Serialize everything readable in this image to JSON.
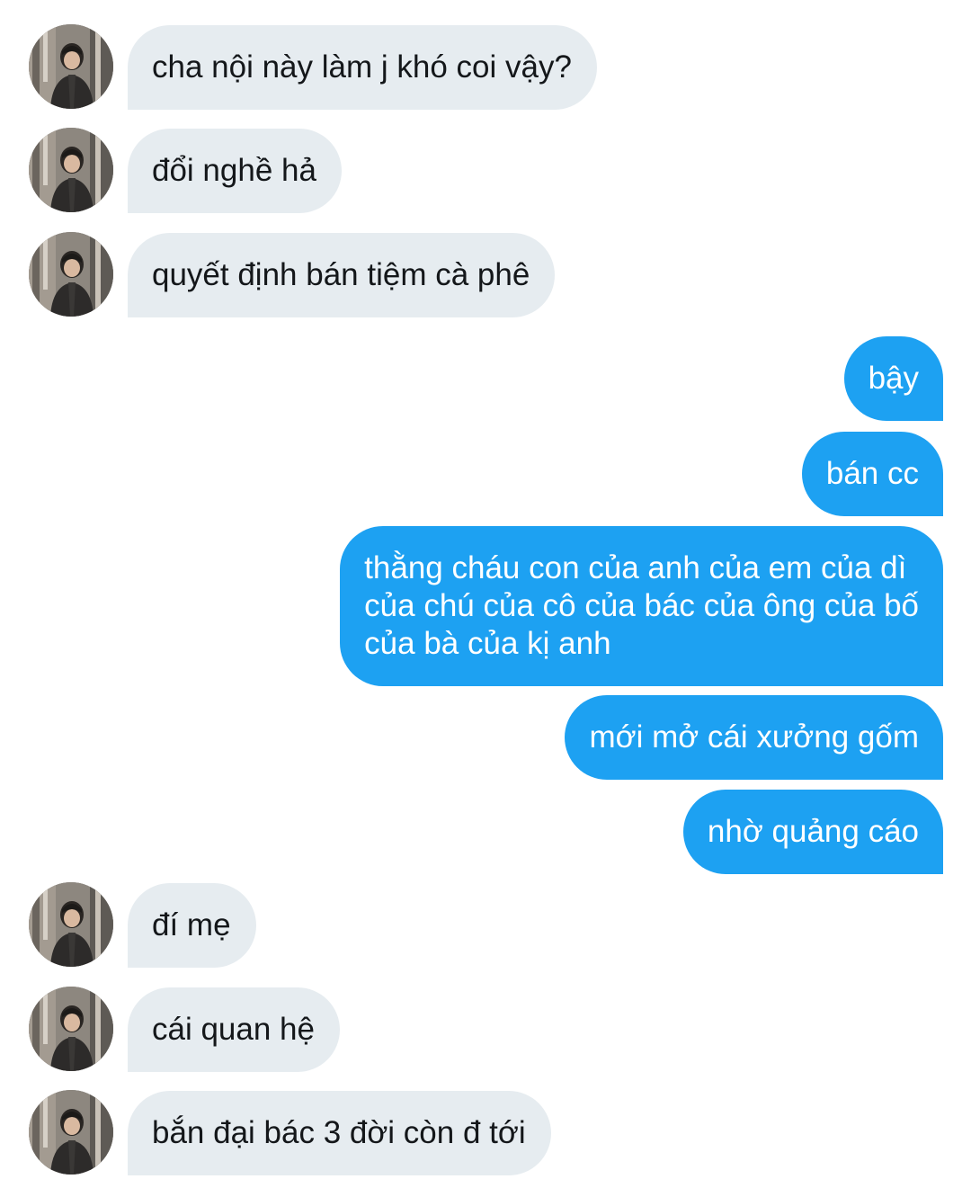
{
  "conversation": {
    "messages": [
      {
        "sender": "them",
        "text": "cha nội này làm j khó coi vậy?"
      },
      {
        "sender": "them",
        "text": "đổi nghề hả"
      },
      {
        "sender": "them",
        "text": "quyết định bán tiệm cà phê"
      },
      {
        "sender": "me",
        "text": "bậy"
      },
      {
        "sender": "me",
        "text": "bán cc"
      },
      {
        "sender": "me",
        "text": "thằng cháu con của anh của em của dì\ncủa chú của cô của bác của ông của bố\ncủa bà của kị anh"
      },
      {
        "sender": "me",
        "text": "mới mở cái xưởng gốm"
      },
      {
        "sender": "me",
        "text": "nhờ quảng cáo"
      },
      {
        "sender": "them",
        "text": "đí mẹ"
      },
      {
        "sender": "them",
        "text": "cái quan hệ"
      },
      {
        "sender": "them",
        "text": "bắn đại bác 3 đời còn đ tới"
      }
    ]
  },
  "avatar_icon": "contact-avatar-photo",
  "colors": {
    "incoming_bubble": "#e6ecf0",
    "incoming_text": "#14171a",
    "outgoing_bubble": "#1da1f2",
    "outgoing_text": "#ffffff",
    "background": "#ffffff"
  }
}
